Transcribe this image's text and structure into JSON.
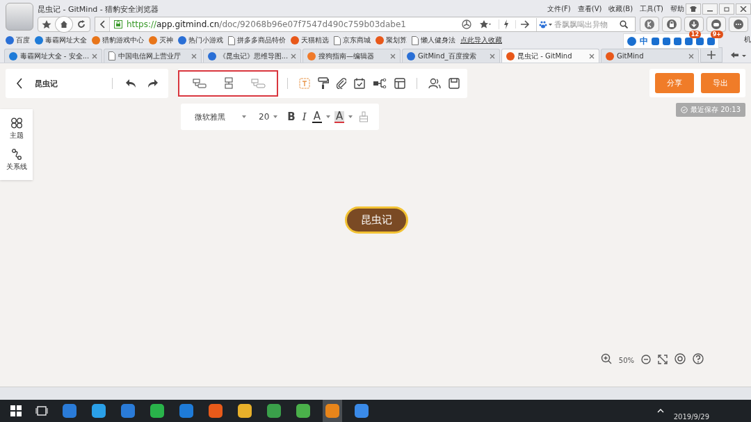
{
  "browser": {
    "title": "昆虫记 - GitMind - 猎豹安全浏览器",
    "menu": [
      "文件(F)",
      "查看(V)",
      "收藏(B)",
      "工具(T)",
      "帮助"
    ],
    "url": {
      "scheme": "https://",
      "host": "app.gitmind.cn",
      "path": "/doc/92068b96e07f7547d490c759b03dabe1"
    },
    "search": {
      "placeholder": "香飘飘喝出异物"
    },
    "badges": [
      "12",
      "9+"
    ],
    "bookmarks": [
      {
        "label": "百度",
        "kind": "paw"
      },
      {
        "label": "毒霸网址大全",
        "kind": "k"
      },
      {
        "label": "猎豹游戏中心",
        "kind": "fox"
      },
      {
        "label": "灭神",
        "kind": "fox"
      },
      {
        "label": "热门小游戏",
        "kind": "b"
      },
      {
        "label": "拼多多商品特价",
        "kind": "page"
      },
      {
        "label": "天猫精选",
        "kind": "tao"
      },
      {
        "label": "京东商城",
        "kind": "page"
      },
      {
        "label": "聚划算",
        "kind": "tao"
      },
      {
        "label": "懒人健身法",
        "kind": "page"
      }
    ],
    "import_link": "点此导入收藏",
    "ime_label": "中",
    "bookmark_edge": "机",
    "tabs": [
      {
        "label": "毒霸网址大全 - 安全...",
        "kind": "k",
        "selected": false
      },
      {
        "label": "中国电信网上营业厅",
        "kind": "page",
        "selected": false
      },
      {
        "label": "《昆虫记》思维导图...",
        "kind": "paw",
        "selected": false
      },
      {
        "label": "搜狗指南—编辑器",
        "kind": "s",
        "selected": false
      },
      {
        "label": "GitMind_百度搜索",
        "kind": "paw",
        "selected": false
      },
      {
        "label": "昆虫记 - GitMind",
        "kind": "gm",
        "selected": true
      },
      {
        "label": "GitMind",
        "kind": "gm",
        "selected": false
      }
    ]
  },
  "app": {
    "doc_title": "昆虫记",
    "format": {
      "font": "微软雅黑",
      "size": "20",
      "bold": "B",
      "italic": "I",
      "font_color": "A",
      "highlight": "A"
    },
    "share": "分享",
    "export": "导出",
    "saved": "最近保存 20:13",
    "side": [
      {
        "label": "主题",
        "kind": "theme"
      },
      {
        "label": "关系线",
        "kind": "relation"
      }
    ],
    "node": "昆虫记",
    "zoom": "50%"
  },
  "taskbar": {
    "clock": "2019/9/29"
  }
}
